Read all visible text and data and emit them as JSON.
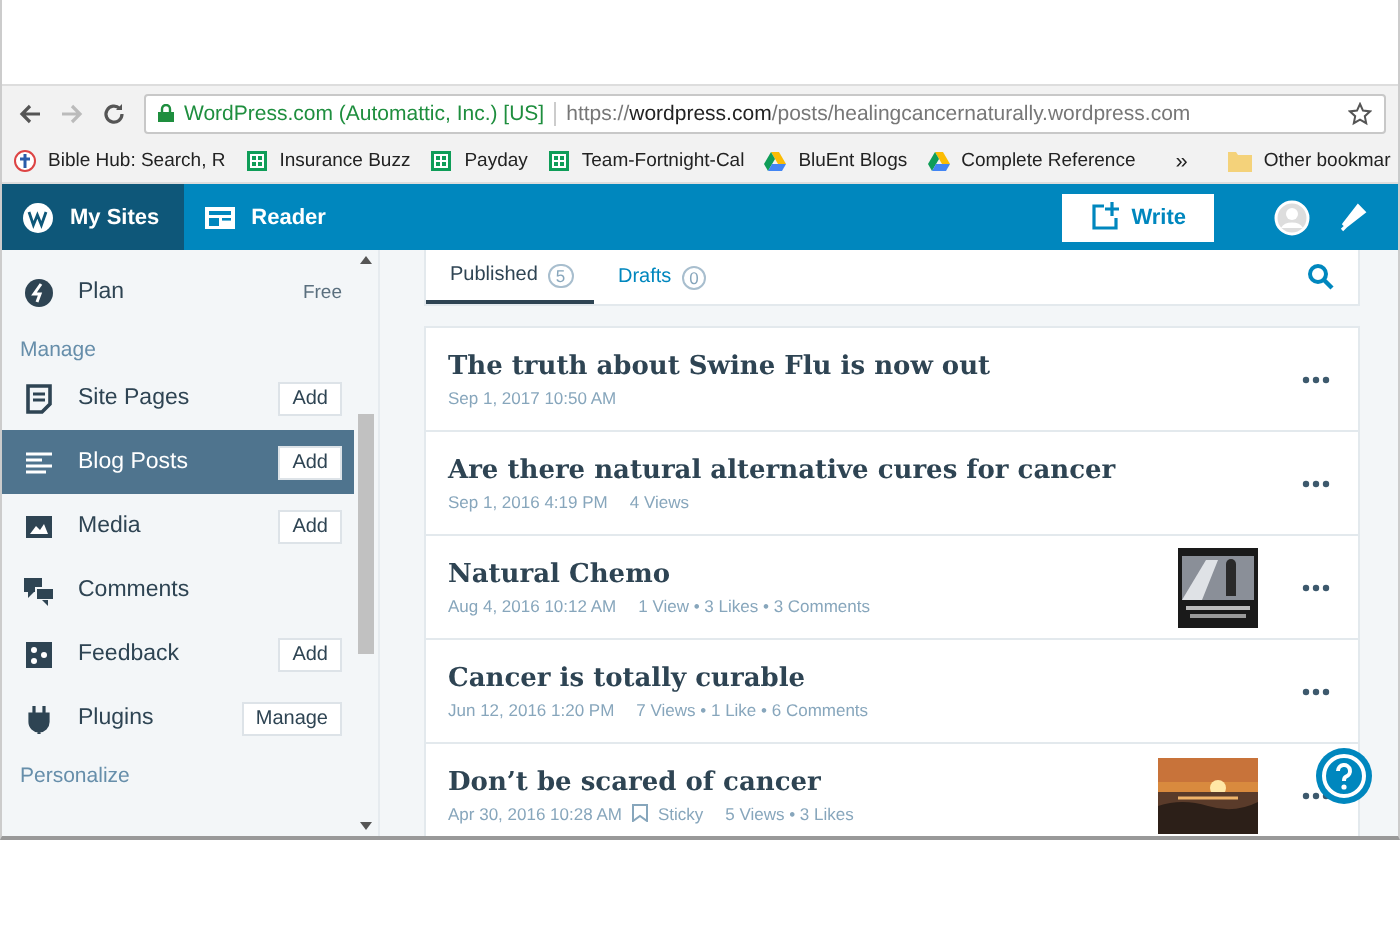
{
  "browser": {
    "site_identity": "WordPress.com (Automattic, Inc.) [US]",
    "url_scheme": "https://",
    "url_host": "wordpress.com",
    "url_path": "/posts/healingcancernaturally.wordpress.com",
    "bookmarks": [
      {
        "kind": "cross",
        "label": "Bible Hub: Search, R"
      },
      {
        "kind": "sheet",
        "label": "Insurance Buzz"
      },
      {
        "kind": "sheet",
        "label": "Payday"
      },
      {
        "kind": "sheet",
        "label": "Team-Fortnight-Cal"
      },
      {
        "kind": "drive",
        "label": "BluEnt Blogs"
      },
      {
        "kind": "drive",
        "label": "Complete Reference"
      }
    ],
    "overflow": "»",
    "other_bookmarks": "Other bookmar"
  },
  "masterbar": {
    "tabs": [
      {
        "kind": "sites",
        "label": "My Sites",
        "selected": true
      },
      {
        "kind": "reader",
        "label": "Reader",
        "selected": false
      }
    ],
    "write": "Write"
  },
  "sidebar": {
    "items": [
      {
        "kind": "item",
        "label": "Plan",
        "tag": "Free",
        "selected": false
      },
      {
        "kind": "heading",
        "label": "Manage"
      },
      {
        "kind": "item",
        "label": "Site Pages",
        "action": "Add",
        "selected": false
      },
      {
        "kind": "item",
        "label": "Blog Posts",
        "action": "Add",
        "selected": true
      },
      {
        "kind": "item",
        "label": "Media",
        "action": "Add",
        "selected": false
      },
      {
        "kind": "item",
        "label": "Comments",
        "selected": false
      },
      {
        "kind": "item",
        "label": "Feedback",
        "action": "Add",
        "selected": false
      },
      {
        "kind": "item",
        "label": "Plugins",
        "action": "Manage",
        "selected": false
      },
      {
        "kind": "heading",
        "label": "Personalize"
      }
    ]
  },
  "tabs": [
    {
      "label": "Published",
      "count": "5",
      "selected": true
    },
    {
      "label": "Drafts",
      "count": "0",
      "selected": false
    }
  ],
  "posts": [
    {
      "title": "The truth about Swine Flu is now out",
      "date": "Sep 1, 2017 10:50 AM"
    },
    {
      "title": "Are there natural alternative cures for cancer",
      "date": "Sep 1, 2016 4:19 PM",
      "stats": "4 Views"
    },
    {
      "title": "Natural Chemo",
      "date": "Aug 4, 2016 10:12 AM",
      "stats": "1 View • 3 Likes • 3 Comments"
    },
    {
      "title": "Cancer is totally curable",
      "date": "Jun 12, 2016 1:20 PM",
      "stats": "7 Views • 1 Like • 6 Comments"
    },
    {
      "title": "Don’t be scared of cancer",
      "date": "Apr 30, 2016 10:28 AM",
      "sticky_label": "Sticky",
      "stats": "5 Views • 3 Likes"
    }
  ]
}
